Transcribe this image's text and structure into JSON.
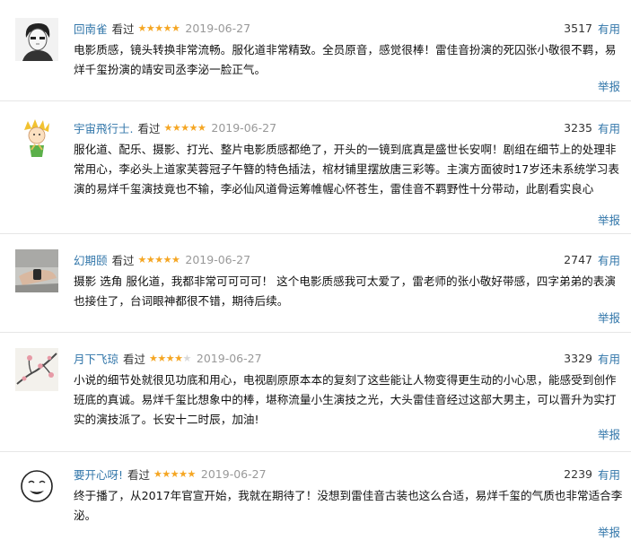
{
  "labels": {
    "seen": "看过",
    "useful": "有用",
    "report": "举报"
  },
  "colors": {
    "link": "#3377aa",
    "star": "#f5a623",
    "star_empty": "#d8d8d8",
    "date": "#999999"
  },
  "reviews": [
    {
      "user": "回南雀",
      "rating": 5,
      "date": "2019-06-27",
      "votes": "3517",
      "avatar": "sketch-portrait",
      "text": "电影质感，镜头转换非常流畅。服化道非常精致。全员原音，感觉很棒！雷佳音扮演的死囚张小敬很不羁，易烊千玺扮演的靖安司丞李泌一脸正气。"
    },
    {
      "user": "宇宙飛行士.",
      "rating": 5,
      "date": "2019-06-27",
      "votes": "3235",
      "avatar": "little-prince-cartoon",
      "text": "服化道、配乐、摄影、打光、整片电影质感都绝了，开头的一镜到底真是盛世长安啊！剧组在细节上的处理非常用心，李必头上道家芙蓉冠子午簪的特色插法，棺材铺里摆放唐三彩等。主演方面彼时17岁还未系统学习表演的易烊千玺演技竟也不输，李必仙风道骨运筹帷幄心怀苍生，雷佳音不羁野性十分带动，此剧看实良心"
    },
    {
      "user": "幻期颐",
      "rating": 5,
      "date": "2019-06-27",
      "votes": "2747",
      "avatar": "hand-photo",
      "text": "摄影 选角 服化道，我都非常可可可可！ 这个电影质感我可太爱了，雷老师的张小敬好带感，四字弟弟的表演也接住了，台词眼神都很不错，期待后续。"
    },
    {
      "user": "月下飞琼",
      "rating": 4,
      "date": "2019-06-27",
      "votes": "3329",
      "avatar": "plum-blossom-painting",
      "text": "小说的细节处就很见功底和用心，电视剧原原本本的复刻了这些能让人物变得更生动的小心思，能感受到创作班底的真诚。易烊千玺比想象中的棒，堪称流量小生演技之光，大头雷佳音经过这部大男主，可以晋升为实打实的演技派了。长安十二时辰，加油!"
    },
    {
      "user": "要开心呀!",
      "rating": 5,
      "date": "2019-06-27",
      "votes": "2239",
      "avatar": "doodle-face",
      "text": "终于播了，从2017年官宣开始，我就在期待了！没想到雷佳音古装也这么合适，易烊千玺的气质也非常适合李泌。"
    }
  ]
}
